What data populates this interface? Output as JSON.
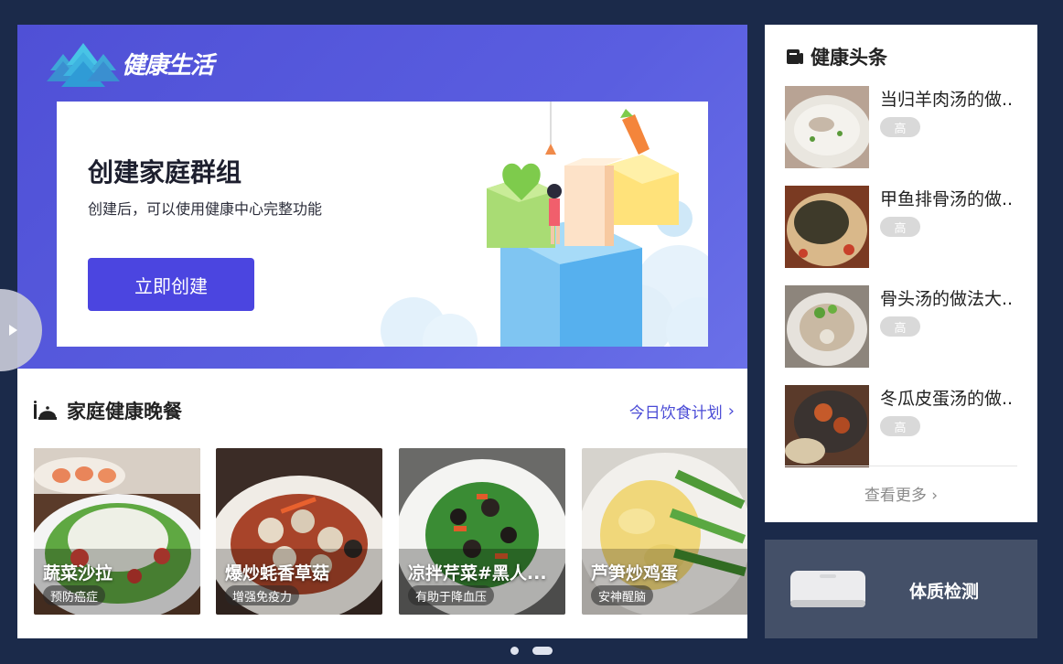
{
  "hero": {
    "brand_name": "健康生活",
    "title": "创建家庭群组",
    "subtitle": "创建后，可以使用健康中心完整功能",
    "create_button": "立即创建"
  },
  "dinner": {
    "title": "家庭健康晚餐",
    "plan_link": "今日饮食计划",
    "meals": [
      {
        "name": "蔬菜沙拉",
        "tag": "预防癌症"
      },
      {
        "name": "爆炒蚝香草菇",
        "tag": "增强免疫力"
      },
      {
        "name": "凉拌芹菜#黑人...",
        "tag": "有助于降血压"
      },
      {
        "name": "芦笋炒鸡蛋",
        "tag": "安神醒脑"
      }
    ]
  },
  "news": {
    "title": "健康头条",
    "items": [
      {
        "title": "当归羊肉汤的做..",
        "badge": "高"
      },
      {
        "title": "甲鱼排骨汤的做..",
        "badge": "高"
      },
      {
        "title": "骨头汤的做法大..",
        "badge": "高"
      },
      {
        "title": "冬瓜皮蛋汤的做..",
        "badge": "高"
      }
    ],
    "more": "查看更多"
  },
  "body_check": {
    "label": "体质检测"
  },
  "colors": {
    "background": "#1b2a4a",
    "hero_blue": "#5457dc",
    "button": "#4b45e0",
    "link": "#4a4bd6",
    "body_check_bg": "#445068"
  },
  "icons": [
    "tree-logo-icon",
    "dinner-bell-icon",
    "chevron-right-icon",
    "newspaper-icon",
    "play-triangle-icon"
  ]
}
